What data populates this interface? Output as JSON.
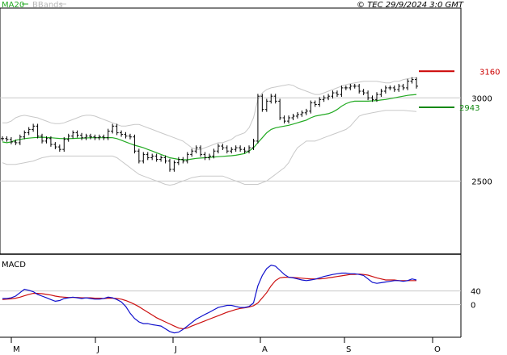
{
  "header": {
    "ma_label": "MA20",
    "bbands_label": "BBands",
    "timestamp": "© TEC 29/9/2024 3:0 GMT"
  },
  "colors": {
    "price": "#000000",
    "ma": "#22aa22",
    "bbands": "#c8c8c8",
    "macd": "#1010cc",
    "signal": "#cc1010",
    "resistance": "#cc0000",
    "support": "#118811",
    "gridline": "#c8c8c8"
  },
  "chart_data": [
    {
      "type": "line",
      "title": "",
      "y_ticks": [
        {
          "value": 2500,
          "label": "2500"
        },
        {
          "value": 3000,
          "label": "3000"
        }
      ],
      "ylim": [
        2070,
        3530
      ],
      "x_months": [
        "M",
        "J",
        "J",
        "A",
        "S",
        "O"
      ],
      "levels": [
        {
          "name": "resistance",
          "value": 3160,
          "label": "3160"
        },
        {
          "name": "support",
          "value": 2943,
          "label": "2943"
        }
      ],
      "series": [
        {
          "name": "price",
          "values": [
            2755,
            2750,
            2735,
            2730,
            2765,
            2790,
            2810,
            2830,
            2770,
            2740,
            2755,
            2720,
            2705,
            2690,
            2750,
            2770,
            2790,
            2775,
            2760,
            2770,
            2765,
            2760,
            2765,
            2760,
            2800,
            2830,
            2790,
            2780,
            2770,
            2765,
            2680,
            2620,
            2660,
            2640,
            2650,
            2630,
            2640,
            2620,
            2570,
            2610,
            2630,
            2620,
            2660,
            2680,
            2700,
            2660,
            2640,
            2650,
            2680,
            2710,
            2700,
            2680,
            2690,
            2700,
            2690,
            2680,
            2700,
            2740,
            3010,
            2930,
            2980,
            3010,
            2980,
            2880,
            2860,
            2880,
            2890,
            2900,
            2910,
            2920,
            2970,
            2960,
            2990,
            3000,
            3010,
            3030,
            3020,
            3060,
            3060,
            3070,
            3070,
            3040,
            3030,
            3000,
            2990,
            3020,
            3040,
            3060,
            3060,
            3050,
            3070,
            3060,
            3100,
            3110,
            3070
          ]
        },
        {
          "name": "MA20",
          "values": [
            2735,
            2730,
            2735,
            2745,
            2750,
            2755,
            2758,
            2760,
            2762,
            2763,
            2762,
            2760,
            2758,
            2756,
            2755,
            2755,
            2756,
            2757,
            2758,
            2759,
            2760,
            2760,
            2760,
            2760,
            2761,
            2760,
            2755,
            2745,
            2735,
            2725,
            2715,
            2708,
            2700,
            2690,
            2680,
            2670,
            2660,
            2650,
            2640,
            2635,
            2630,
            2628,
            2628,
            2632,
            2636,
            2638,
            2640,
            2642,
            2644,
            2646,
            2648,
            2650,
            2652,
            2655,
            2660,
            2665,
            2680,
            2700,
            2730,
            2760,
            2790,
            2810,
            2820,
            2825,
            2830,
            2835,
            2842,
            2850,
            2858,
            2866,
            2880,
            2890,
            2895,
            2900,
            2905,
            2915,
            2930,
            2950,
            2965,
            2975,
            2980,
            2980,
            2980,
            2980,
            2982,
            2984,
            2987,
            2990,
            2995,
            3000,
            3005,
            3010,
            3015,
            3018,
            3020
          ]
        },
        {
          "name": "BBands upper",
          "values": [
            2850,
            2850,
            2860,
            2880,
            2890,
            2895,
            2890,
            2885,
            2880,
            2870,
            2860,
            2850,
            2845,
            2845,
            2850,
            2860,
            2870,
            2880,
            2890,
            2895,
            2895,
            2890,
            2880,
            2870,
            2860,
            2850,
            2840,
            2830,
            2830,
            2835,
            2840,
            2840,
            2830,
            2820,
            2810,
            2800,
            2790,
            2780,
            2770,
            2760,
            2750,
            2740,
            2720,
            2700,
            2690,
            2690,
            2700,
            2710,
            2720,
            2730,
            2730,
            2740,
            2750,
            2770,
            2780,
            2790,
            2820,
            2880,
            2990,
            3030,
            3050,
            3060,
            3065,
            3070,
            3075,
            3080,
            3075,
            3060,
            3050,
            3040,
            3030,
            3020,
            3020,
            3030,
            3040,
            3050,
            3060,
            3070,
            3080,
            3085,
            3090,
            3095,
            3100,
            3100,
            3100,
            3100,
            3095,
            3090,
            3090,
            3100,
            3100,
            3110,
            3115,
            3120,
            3120
          ]
        },
        {
          "name": "BBands lower",
          "values": [
            2610,
            2600,
            2600,
            2600,
            2605,
            2610,
            2615,
            2620,
            2630,
            2640,
            2645,
            2650,
            2650,
            2650,
            2650,
            2650,
            2650,
            2650,
            2650,
            2650,
            2650,
            2650,
            2650,
            2650,
            2650,
            2650,
            2640,
            2620,
            2600,
            2580,
            2560,
            2540,
            2530,
            2520,
            2510,
            2500,
            2490,
            2480,
            2475,
            2480,
            2490,
            2500,
            2510,
            2520,
            2525,
            2530,
            2530,
            2530,
            2530,
            2530,
            2530,
            2520,
            2510,
            2500,
            2490,
            2480,
            2480,
            2480,
            2480,
            2490,
            2500,
            2520,
            2540,
            2560,
            2580,
            2610,
            2660,
            2700,
            2720,
            2740,
            2740,
            2740,
            2750,
            2760,
            2770,
            2780,
            2790,
            2800,
            2810,
            2830,
            2860,
            2890,
            2900,
            2905,
            2910,
            2915,
            2920,
            2925,
            2925,
            2925,
            2925,
            2925,
            2922,
            2920,
            2918
          ]
        }
      ]
    },
    {
      "type": "line",
      "title": "MACD",
      "y_ticks": [
        {
          "value": 40,
          "label": "40"
        },
        {
          "value": 0,
          "label": "0"
        }
      ],
      "ylim": [
        -90,
        140
      ],
      "series": [
        {
          "name": "MACD",
          "values": [
            18,
            18,
            20,
            25,
            35,
            45,
            42,
            38,
            30,
            25,
            20,
            15,
            10,
            12,
            18,
            20,
            22,
            20,
            18,
            20,
            18,
            16,
            16,
            18,
            22,
            20,
            15,
            8,
            -5,
            -25,
            -40,
            -50,
            -55,
            -55,
            -58,
            -60,
            -62,
            -70,
            -78,
            -82,
            -80,
            -72,
            -62,
            -52,
            -42,
            -35,
            -28,
            -22,
            -15,
            -8,
            -5,
            -2,
            -2,
            -5,
            -8,
            -8,
            -5,
            5,
            55,
            85,
            105,
            115,
            112,
            100,
            88,
            80,
            78,
            75,
            72,
            70,
            72,
            74,
            78,
            82,
            85,
            88,
            90,
            92,
            92,
            90,
            90,
            88,
            85,
            75,
            65,
            62,
            64,
            66,
            68,
            70,
            70,
            68,
            70,
            75,
            72
          ]
        },
        {
          "name": "Signal",
          "values": [
            15,
            16,
            17,
            19,
            22,
            26,
            30,
            33,
            33,
            32,
            30,
            28,
            25,
            23,
            22,
            21,
            21,
            21,
            20,
            20,
            20,
            19,
            19,
            18,
            19,
            19,
            18,
            16,
            12,
            7,
            1,
            -6,
            -14,
            -22,
            -30,
            -38,
            -44,
            -50,
            -56,
            -62,
            -68,
            -70,
            -68,
            -62,
            -57,
            -52,
            -47,
            -42,
            -37,
            -32,
            -27,
            -22,
            -18,
            -14,
            -11,
            -9,
            -7,
            -3,
            5,
            20,
            35,
            55,
            70,
            78,
            80,
            80,
            79,
            78,
            77,
            76,
            75,
            75,
            75,
            76,
            78,
            80,
            82,
            84,
            86,
            88,
            88,
            89,
            88,
            86,
            82,
            78,
            75,
            72,
            72,
            72,
            70,
            70,
            70,
            70,
            70
          ]
        }
      ]
    }
  ]
}
